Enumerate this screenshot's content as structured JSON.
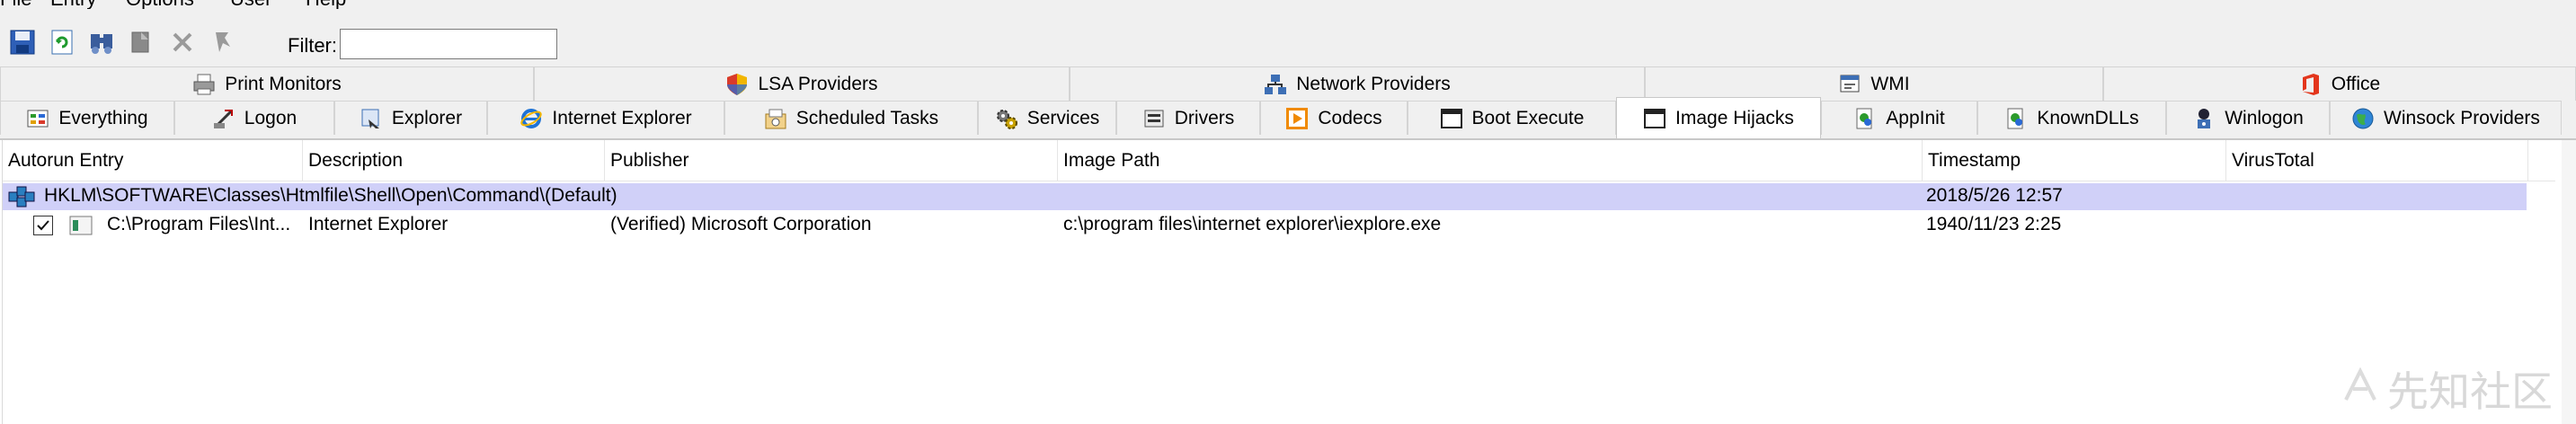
{
  "menu": {
    "items": [
      "File",
      "Entry",
      "Options",
      "User",
      "Help"
    ]
  },
  "toolbar": {
    "buttons": [
      "save-icon",
      "refresh-icon",
      "find-icon",
      "copy-icon",
      "delete-icon",
      "jump-icon"
    ],
    "filter_label": "Filter:",
    "filter_value": ""
  },
  "tabs": {
    "row1": [
      {
        "label": "Print Monitors",
        "icon": "printer-icon"
      },
      {
        "label": "LSA Providers",
        "icon": "shield-icon"
      },
      {
        "label": "Network Providers",
        "icon": "network-icon"
      },
      {
        "label": "WMI",
        "icon": "wmi-icon"
      },
      {
        "label": "Office",
        "icon": "office-icon"
      }
    ],
    "row2": [
      {
        "label": "Everything",
        "icon": "everything-icon"
      },
      {
        "label": "Logon",
        "icon": "logon-icon"
      },
      {
        "label": "Explorer",
        "icon": "explorer-icon"
      },
      {
        "label": "Internet Explorer",
        "icon": "ie-icon"
      },
      {
        "label": "Scheduled Tasks",
        "icon": "task-icon"
      },
      {
        "label": "Services",
        "icon": "gears-icon"
      },
      {
        "label": "Drivers",
        "icon": "driver-icon"
      },
      {
        "label": "Codecs",
        "icon": "codec-icon"
      },
      {
        "label": "Boot Execute",
        "icon": "window-icon"
      },
      {
        "label": "Image Hijacks",
        "icon": "window-icon"
      },
      {
        "label": "AppInit",
        "icon": "appinit-icon"
      },
      {
        "label": "KnownDLLs",
        "icon": "dll-icon"
      },
      {
        "label": "Winlogon",
        "icon": "winlogon-icon"
      },
      {
        "label": "Winsock Providers",
        "icon": "globe-icon"
      }
    ],
    "active": "Image Hijacks"
  },
  "columns": [
    "Autorun Entry",
    "Description",
    "Publisher",
    "Image Path",
    "Timestamp",
    "VirusTotal"
  ],
  "group": {
    "key": "HKLM\\SOFTWARE\\Classes\\Htmlfile\\Shell\\Open\\Command\\(Default)",
    "timestamp": "2018/5/26 12:57"
  },
  "rows": [
    {
      "checked": true,
      "entry": "C:\\Program Files\\Int...",
      "description": "Internet Explorer",
      "publisher": "(Verified) Microsoft Corporation",
      "image_path": "c:\\program files\\internet explorer\\iexplore.exe",
      "timestamp": "1940/11/23 2:25",
      "virustotal": ""
    }
  ],
  "watermark": "先知社区",
  "colors": {
    "group_row_bg": "#d0d0f8",
    "toolbar_bg": "#f0f0f0"
  }
}
